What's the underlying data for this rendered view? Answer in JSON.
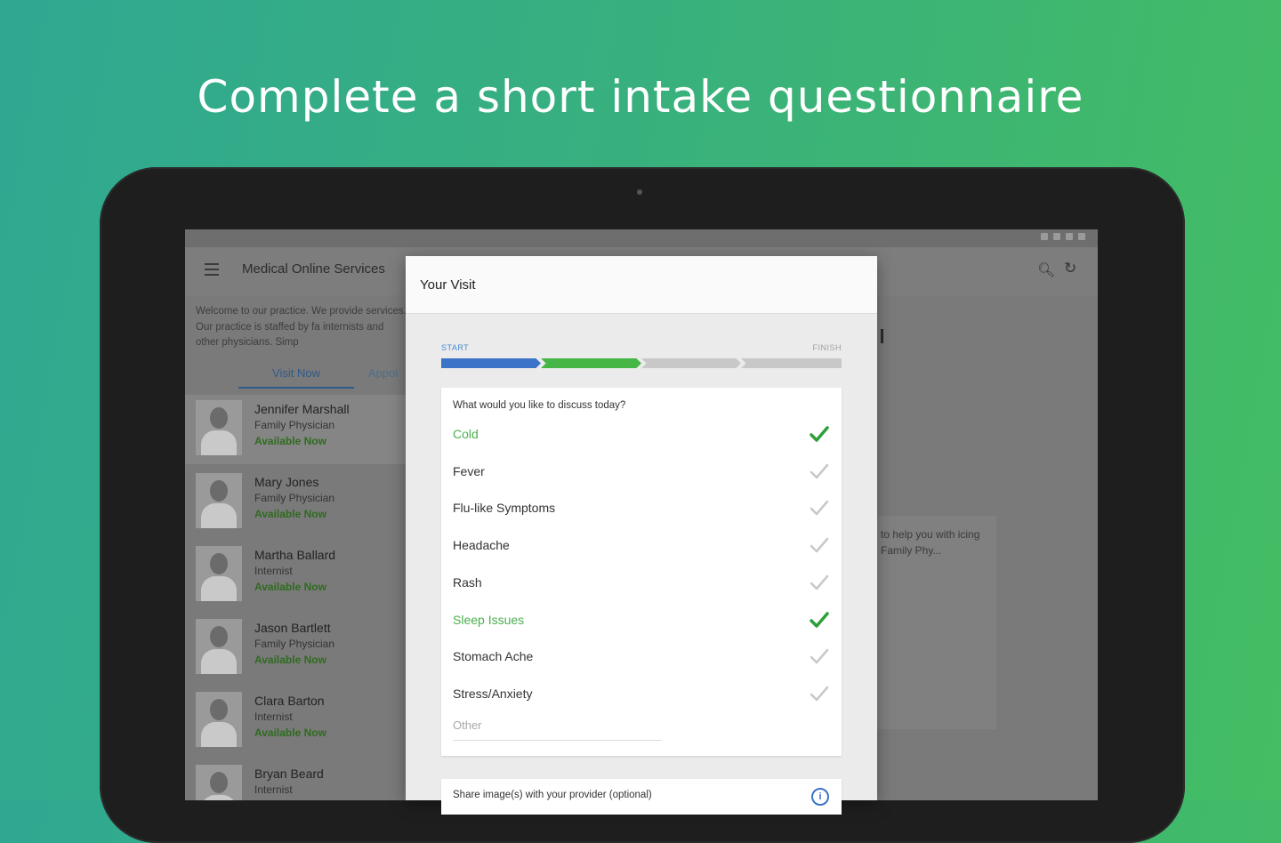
{
  "headline": "Complete a short intake questionnaire",
  "app": {
    "title": "Medical Online Services",
    "intro": "Welcome to our practice. We provide services. Our practice is staffed by fa internists and other physicians. Simp",
    "tabs": [
      "Visit Now",
      "Appoi"
    ],
    "right_text": "to help you with icing Family Phy...",
    "icons": {
      "menu": "menu-icon",
      "search": "search-icon",
      "refresh": "refresh-icon"
    }
  },
  "doctors": [
    {
      "name": "Jennifer Marshall",
      "role": "Family Physician",
      "status": "Available Now"
    },
    {
      "name": "Mary Jones",
      "role": "Family Physician",
      "status": "Available Now"
    },
    {
      "name": "Martha Ballard",
      "role": "Internist",
      "status": "Available Now"
    },
    {
      "name": "Jason Bartlett",
      "role": "Family Physician",
      "status": "Available Now"
    },
    {
      "name": "Clara Barton",
      "role": "Internist",
      "status": "Available Now"
    },
    {
      "name": "Bryan Beard",
      "role": "Internist",
      "status": ""
    }
  ],
  "dialog": {
    "title": "Your Visit",
    "progress": {
      "start_label": "START",
      "finish_label": "FINISH",
      "completed_steps": 2,
      "total_steps": 4
    },
    "question": "What would you like to discuss today?",
    "options": [
      {
        "label": "Cold",
        "selected": true
      },
      {
        "label": "Fever",
        "selected": false
      },
      {
        "label": "Flu-like Symptoms",
        "selected": false
      },
      {
        "label": "Headache",
        "selected": false
      },
      {
        "label": "Rash",
        "selected": false
      },
      {
        "label": "Sleep Issues",
        "selected": true
      },
      {
        "label": "Stomach Ache",
        "selected": false
      },
      {
        "label": "Stress/Anxiety",
        "selected": false
      }
    ],
    "other_placeholder": "Other",
    "share_label": "Share image(s) with your provider (optional)"
  },
  "colors": {
    "selected_green": "#4caf50",
    "progress_blue": "#3b73c8",
    "progress_green": "#46b647",
    "check_unselected": "#c8c8c8",
    "check_selected": "#2e9e3a"
  }
}
